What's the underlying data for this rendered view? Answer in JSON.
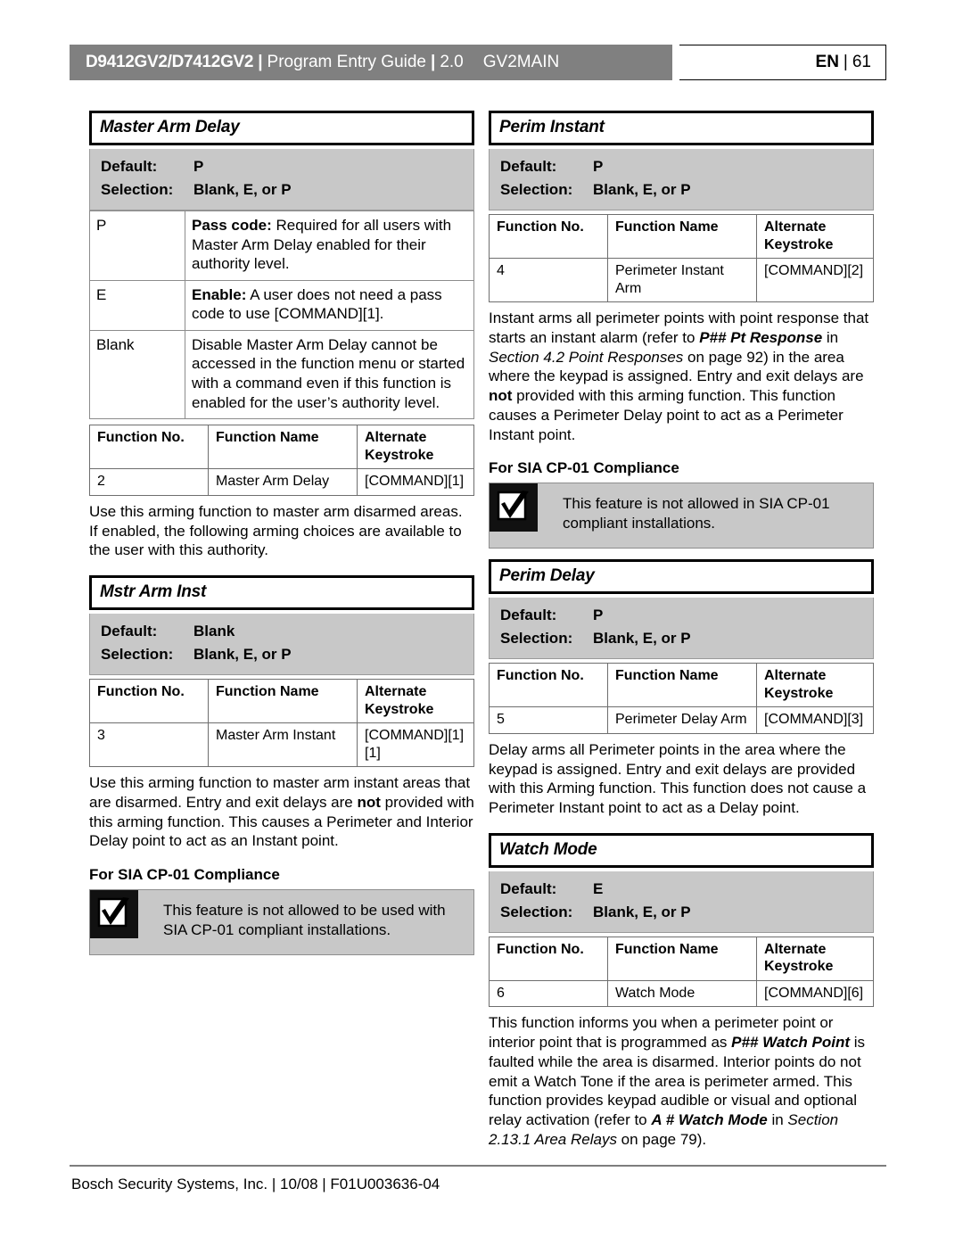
{
  "header": {
    "product": "D9412GV2/D7412GV2",
    "separator": "|",
    "guide": "Program Entry Guide",
    "version": "2.0",
    "module": "GV2MAIN",
    "lang": "EN",
    "page_number": "61"
  },
  "footer": {
    "text": "Bosch Security Systems, Inc. | 10/08 | F01U003636-04"
  },
  "labels": {
    "default": "Default:",
    "selection": "Selection:",
    "fn_no": "Function No.",
    "fn_name": "Function Name",
    "fn_alt": "Alternate Keystroke",
    "compliance_heading": "For SIA CP-01 Compliance"
  },
  "left_column": {
    "master_arm_delay": {
      "title": "Master Arm Delay",
      "default": "P",
      "selection": "Blank, E, or P",
      "detail_rows": [
        {
          "key": "P",
          "bold_lead": "Pass code:",
          "text": " Required for all users with Master Arm Delay enabled for their authority level."
        },
        {
          "key": "E",
          "bold_lead": "Enable:",
          "text": " A user does not need a pass code to use [COMMAND][1]."
        },
        {
          "key": "Blank",
          "bold_lead": "",
          "text": "Disable Master Arm Delay cannot be accessed in the function menu or started with a command even if this function is enabled for the user’s authority level."
        }
      ],
      "function_row": {
        "no": "2",
        "name": "Master Arm Delay",
        "keystroke": "[COMMAND][1]"
      },
      "paragraph": "Use this arming function to master arm disarmed areas. If enabled, the following arming choices are available to the user with this authority."
    },
    "mstr_arm_inst": {
      "title": "Mstr Arm Inst",
      "default": "Blank",
      "selection": "Blank, E, or P",
      "function_row": {
        "no": "3",
        "name": "Master Arm Instant",
        "keystroke": "[COMMAND][1][1]"
      },
      "paragraph_part1": "Use this arming function to master arm instant areas that are disarmed. Entry and exit delays are ",
      "paragraph_bold": "not",
      "paragraph_part2": " provided with this arming function. This causes a Perimeter and Interior Delay point to act as an Instant point.",
      "notice": "This feature is not allowed to be used with SIA CP-01 compliant installations."
    }
  },
  "right_column": {
    "perim_instant": {
      "title": "Perim Instant",
      "default": "P",
      "selection": "Blank, E, or P",
      "function_row": {
        "no": "4",
        "name": "Perimeter Instant Arm",
        "keystroke": "[COMMAND][2]"
      },
      "paragraph_part1": "Instant arms all perimeter points with point response that starts an instant alarm (refer to ",
      "paragraph_bolditalic1": "P## Pt Response",
      "paragraph_part2": " in ",
      "paragraph_italic1": "Section 4.2 Point Responses",
      "paragraph_part3": " on page 92) in the area where the keypad is assigned. Entry and exit delays are ",
      "paragraph_bold1": "not",
      "paragraph_part4": " provided with this arming function. This function causes a Perimeter Delay point to act as a Perimeter Instant point.",
      "notice": "This feature is not allowed in SIA CP-01 compliant installations."
    },
    "perim_delay": {
      "title": "Perim Delay",
      "default": "P",
      "selection": "Blank, E, or P",
      "function_row": {
        "no": "5",
        "name": "Perimeter Delay Arm",
        "keystroke": "[COMMAND][3]"
      },
      "paragraph": "Delay arms all Perimeter points in the area where the keypad is assigned. Entry and exit delays are provided with this Arming function. This function does not cause a Perimeter Instant point to act as a Delay point."
    },
    "watch_mode": {
      "title": "Watch Mode",
      "default": "E",
      "selection": "Blank, E, or P",
      "function_row": {
        "no": "6",
        "name": "Watch Mode",
        "keystroke": "[COMMAND][6]"
      },
      "paragraph_part1": "This function informs you when a perimeter point or interior point that is programmed as ",
      "paragraph_bolditalic1": "P## Watch Point",
      "paragraph_part2": " is faulted while the area is disarmed. Interior points do not emit a Watch Tone if the area is perimeter armed. This function provides keypad audible or visual and optional relay activation (refer to ",
      "paragraph_bolditalic2": "A # Watch Mode",
      "paragraph_part3": " in ",
      "paragraph_italic1": "Section 2.13.1 Area Relays",
      "paragraph_part4": " on page 79)."
    }
  },
  "colors": {
    "header_bar": "#808080",
    "panel_gray": "#c8c8c8",
    "rule_gray": "#7d7d7d"
  }
}
